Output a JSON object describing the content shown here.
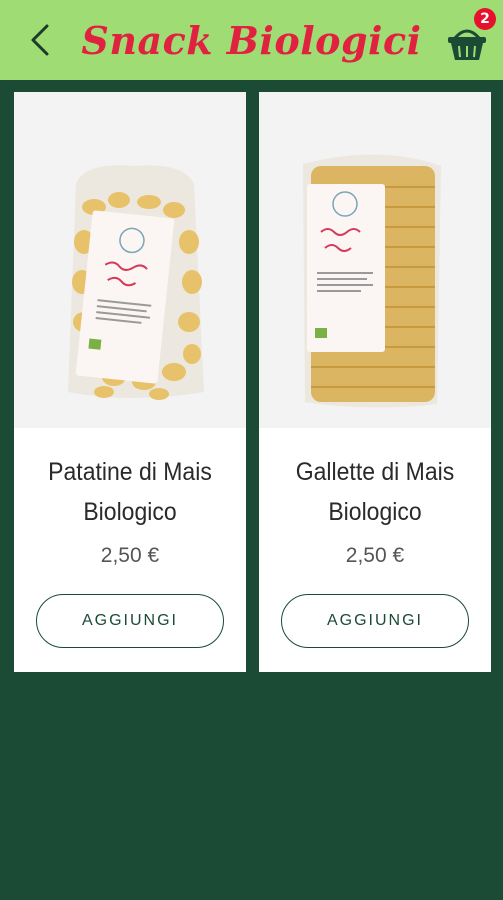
{
  "header": {
    "title": "Snack Biologici",
    "cart_count": "2"
  },
  "products": [
    {
      "name_line1": "Patatine di Mais",
      "name_line2": "Biologico",
      "price": "2,50 €",
      "button_label": "AGGIUNGI",
      "image": "bag-of-corn-puffs"
    },
    {
      "name_line1": "Gallette di Mais",
      "name_line2": "Biologico",
      "price": "2,50 €",
      "button_label": "AGGIUNGI",
      "image": "bag-of-corn-cakes"
    }
  ],
  "colors": {
    "header_bg": "#9fdc74",
    "title": "#e0213f",
    "page_bg": "#1b4a35",
    "badge": "#e8112d"
  }
}
